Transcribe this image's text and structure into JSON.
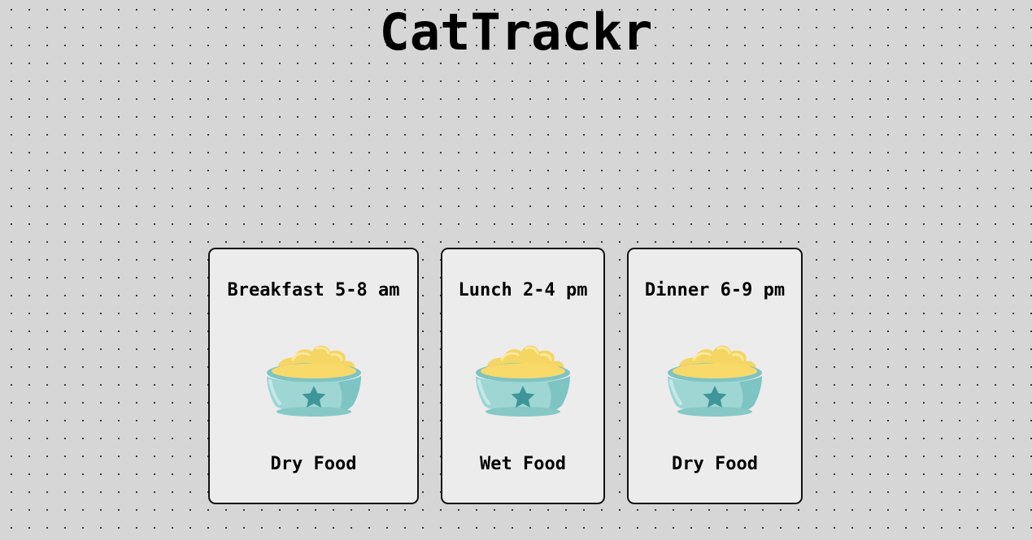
{
  "app": {
    "title": "CatTrackr"
  },
  "meals": [
    {
      "heading": "Breakfast 5-8 am",
      "food": "Dry Food",
      "icon": "food-bowl-icon"
    },
    {
      "heading": "Lunch 2-4 pm",
      "food": "Wet Food",
      "icon": "food-bowl-icon"
    },
    {
      "heading": "Dinner 6-9 pm",
      "food": "Dry Food",
      "icon": "food-bowl-icon"
    }
  ],
  "colors": {
    "background": "#d6d6d6",
    "card": "#ececec",
    "bowl": "#8fcdcb",
    "bowl_shadow": "#6db7b6",
    "food": "#f7d96a",
    "star": "#3f9699"
  }
}
